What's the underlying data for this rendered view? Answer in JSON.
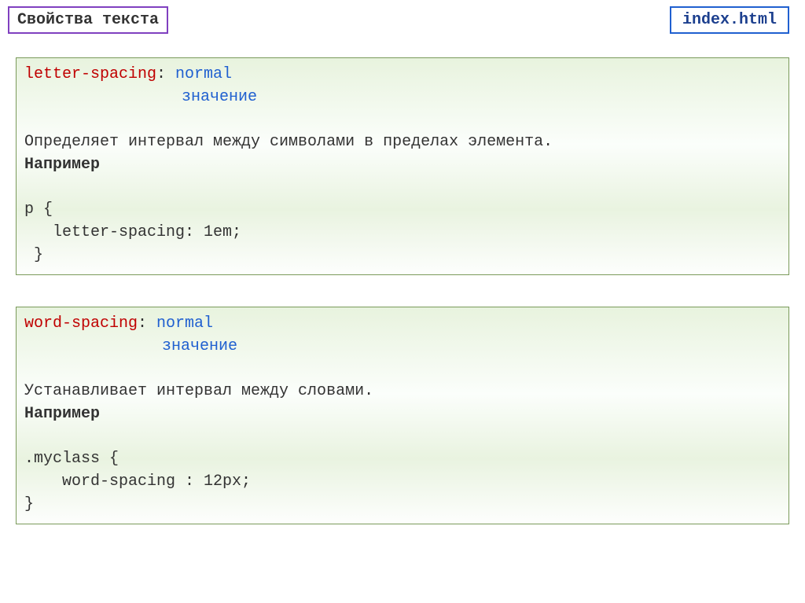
{
  "header": {
    "title": "Свойства текста",
    "filename": "index.html"
  },
  "block1": {
    "property": "letter-spacing",
    "value1": "normal",
    "value2": "значение",
    "description": "Определяет интервал между символами в пределах элемента.",
    "example_label": "Например",
    "code1": "p {",
    "code2": "   letter-spacing: 1em;",
    "code3": " }"
  },
  "block2": {
    "property": "word-spacing",
    "value1": "normal",
    "value2": "значение",
    "description": "Устанавливает интервал между словами.",
    "example_label": "Например",
    "code1": ".myclass {",
    "code2": "    word-spacing : 12px;",
    "code3": "}"
  }
}
